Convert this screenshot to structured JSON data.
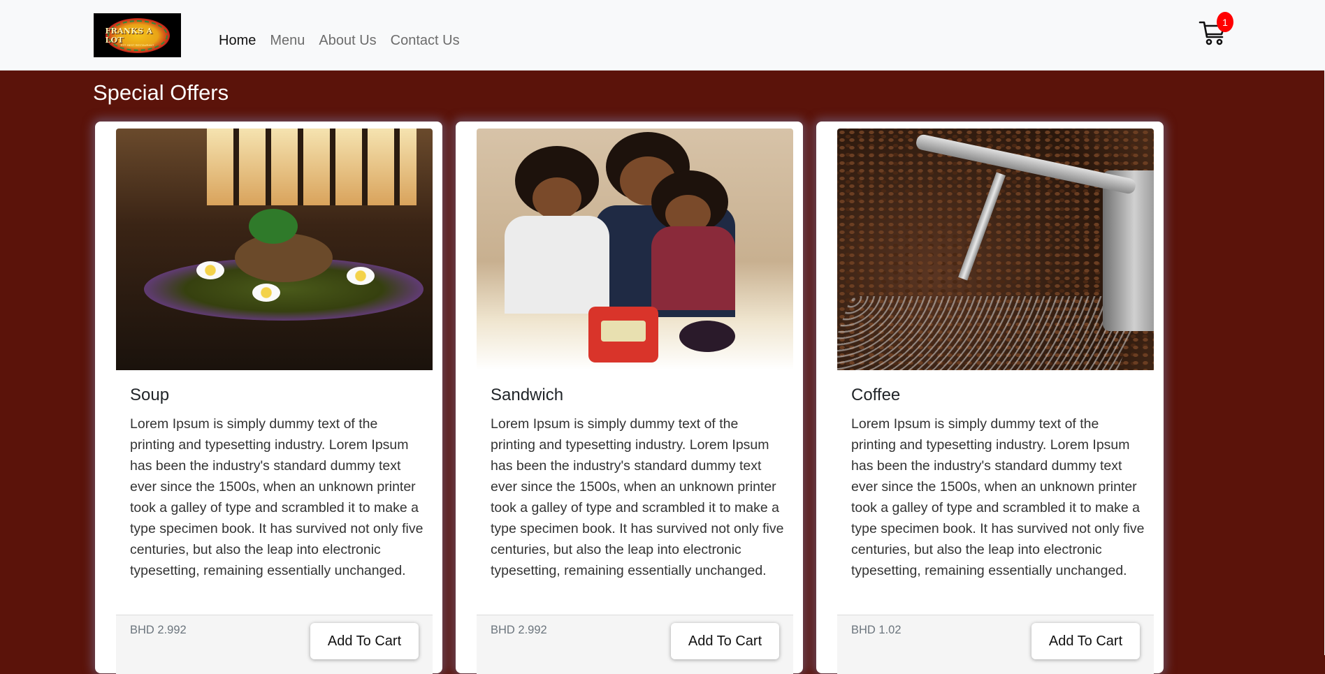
{
  "brand": {
    "logo_text": "FRANKS A LOT",
    "logo_subtext": "EST. BEST RESTAURANT"
  },
  "nav": {
    "items": [
      {
        "label": "Home",
        "active": true
      },
      {
        "label": "Menu",
        "active": false
      },
      {
        "label": "About Us",
        "active": false
      },
      {
        "label": "Contact Us",
        "active": false
      }
    ]
  },
  "cart": {
    "icon": "cart-icon",
    "count": "1",
    "badge_color": "#ff0000"
  },
  "section": {
    "title": "Special Offers"
  },
  "colors": {
    "page_background": "#5b130a",
    "navbar_background": "#f8f9fa",
    "card_background": "#ffffff"
  },
  "products": [
    {
      "name": "Soup",
      "image": "soup-dish-photo",
      "description": "Lorem Ipsum is simply dummy text of the printing and typesetting industry. Lorem Ipsum has been the industry's standard dummy text ever since the 1500s, when an unknown printer took a galley of type and scrambled it to make a type specimen book. It has survived not only five centuries, but also the leap into electronic typesetting, remaining essentially unchanged.",
      "price": "BHD 2.992",
      "button": "Add To Cart"
    },
    {
      "name": "Sandwich",
      "image": "family-sandwich-photo",
      "description": "Lorem Ipsum is simply dummy text of the printing and typesetting industry. Lorem Ipsum has been the industry's standard dummy text ever since the 1500s, when an unknown printer took a galley of type and scrambled it to make a type specimen book. It has survived not only five centuries, but also the leap into electronic typesetting, remaining essentially unchanged.",
      "price": "BHD 2.992",
      "button": "Add To Cart"
    },
    {
      "name": "Coffee",
      "image": "coffee-roaster-photo",
      "description": "Lorem Ipsum is simply dummy text of the printing and typesetting industry. Lorem Ipsum has been the industry's standard dummy text ever since the 1500s, when an unknown printer took a galley of type and scrambled it to make a type specimen book. It has survived not only five centuries, but also the leap into electronic typesetting, remaining essentially unchanged.",
      "price": "BHD 1.02",
      "button": "Add To Cart"
    }
  ]
}
